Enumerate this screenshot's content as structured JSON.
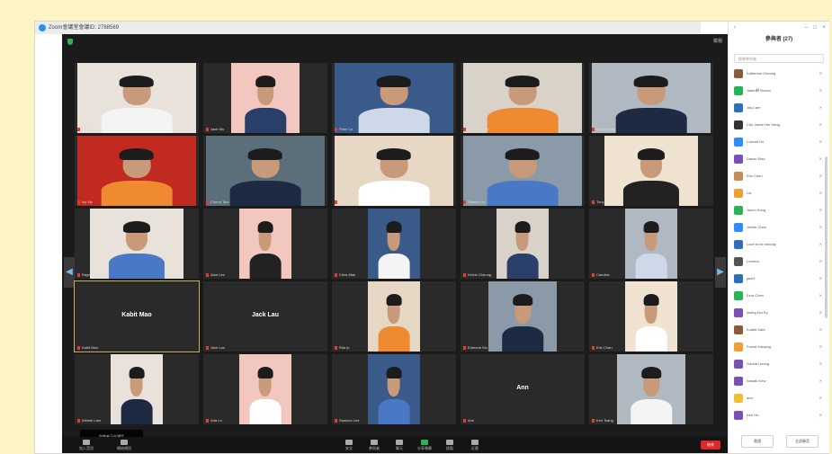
{
  "window": {
    "title": "Zoom會議室會議ID: 2788569"
  },
  "meeting": {
    "view_label": "檢視",
    "participants_row1": [
      "Kent Ng",
      "Jack Wu",
      "Peter Lo",
      "Johnny Chan",
      "Dicky Wong"
    ],
    "participants_row2": [
      "Ivy Yip",
      "Cherry Tam",
      "Calvin Lau",
      "Stanley Ho",
      "Tony Ma"
    ],
    "participants_row3": [
      "Raymond Chu",
      "Alan Lee",
      "Chris Mak",
      "Kelvin Cheung",
      "Candice"
    ],
    "participants_row4": [
      "Kabit Mao",
      "Jack Lau",
      "Rita Ip",
      "Edmond Siu",
      "Eric Chan"
    ],
    "participants_row5": [
      "Winnie Lam",
      "Ada Lo",
      "Samson Lee",
      "Ann",
      "Ken Tsang"
    ],
    "caption": "與會者正在講話",
    "toolbar": [
      "加入音訊",
      "開始視訊",
      "安全",
      "參與者",
      "聊天",
      "分享螢幕",
      "錄製",
      "反應"
    ],
    "end_label": "結束"
  },
  "panel": {
    "title": "參與者 (27)",
    "search_placeholder": "搜尋參與者",
    "participants": [
      "Katherine Cheung",
      "Jasen軒Vinson",
      "Jaq Lam",
      "Chu Jamie Hin Hang",
      "Conrad Ho",
      "Dason Siao",
      "Eric Chen",
      "Lia",
      "Jason Kung",
      "Jerlick Chan",
      "Love to be nobody",
      "Lorenzo",
      "jack3",
      "Ezra Chen",
      "Iwang Hui Ky",
      "Kuatai Kate",
      "Forest Kaisang",
      "Ganria Lieong",
      "Ivasaki Kew",
      "ann",
      "Ken Ho"
    ],
    "invite_label": "邀請",
    "mute_all_label": "全部靜音"
  },
  "colors": {
    "accent": "#2d8cff",
    "end": "#e02828",
    "mic_off": "#e23b3b",
    "highlight": "#c9b15a"
  }
}
